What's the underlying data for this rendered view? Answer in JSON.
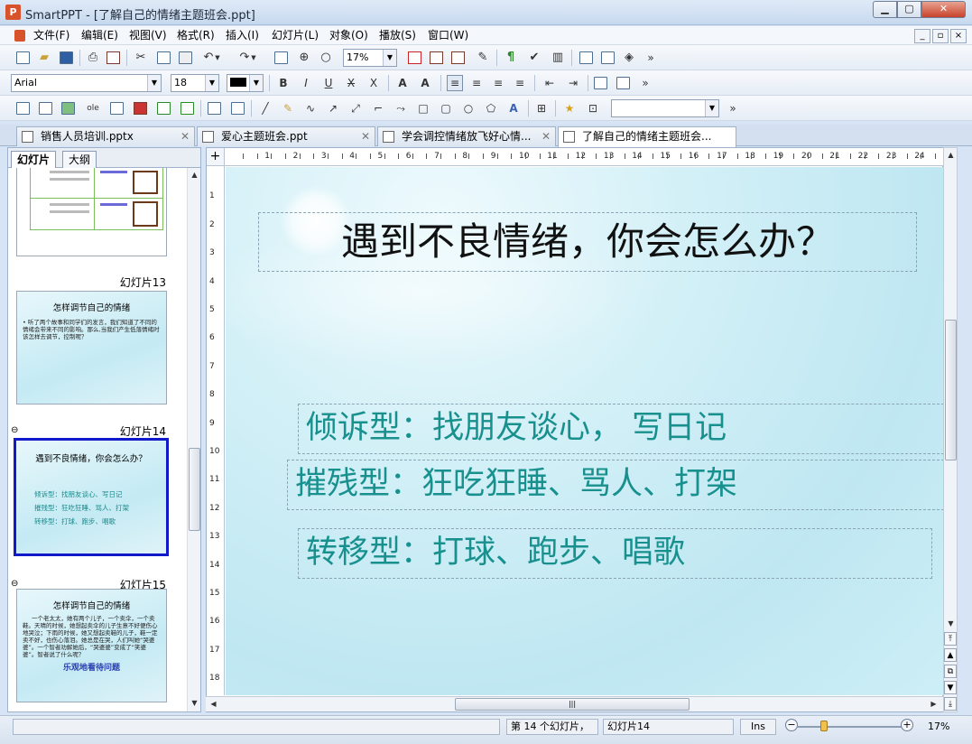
{
  "window": {
    "title": "SmartPPT - [了解自己的情绪主题班会.ppt]",
    "app_icon": "P",
    "min": "▁",
    "max": "▢",
    "close": "✕"
  },
  "menu": [
    "文件(F)",
    "编辑(E)",
    "视图(V)",
    "格式(R)",
    "插入(I)",
    "幻灯片(L)",
    "对象(O)",
    "播放(S)",
    "窗口(W)"
  ],
  "toolbar1": {
    "zoom": "17%",
    "more": "»"
  },
  "toolbar2": {
    "font": "Arial",
    "size": "18",
    "more": "»"
  },
  "toolbar3": {
    "more": "»"
  },
  "tabs": [
    "销售人员培训.pptx",
    "爱心主题班会.ppt",
    "学会调控情绪放飞好心情...",
    "了解自己的情绪主题班会..."
  ],
  "panel_tabs": [
    "幻灯片",
    "大纲"
  ],
  "thumbnails": [
    {
      "label": "幻灯片13",
      "title": "怎样调节自己的情绪",
      "body": "• 听了两个故事和同学们的发言，我们知道了不同的情绪会带来不同的影响。那么,当我们产生低落情绪时该怎样去调节，控制呢？"
    },
    {
      "label": "幻灯片14",
      "title": "遇到不良情绪，你会怎么办？",
      "lines": [
        "倾诉型：找朋友谈心、写日记",
        "摧残型：狂吃狂睡、骂人、打架",
        "转移型：打球、跑步、唱歌"
      ]
    },
    {
      "label": "幻灯片15",
      "title": "怎样调节自己的情绪",
      "body": "一个老太太，她有两个儿子，一个卖伞，一个卖鞋。天晴的时候，她想起卖伞的儿子生意不好便伤心地哭泣；下雨的时候，她又想起卖鞋的儿子，鞋一定卖不好，也伤心落泪。她总是在哭，人们叫她“哭婆婆”。一个智者劝解她后，“哭婆婆”变成了“笑婆婆”。智者说了什么呢？",
      "footer": "乐观地看待问题"
    }
  ],
  "slide": {
    "title": "遇到不良情绪，你会怎么办？",
    "bullets": [
      "倾诉型：找朋友谈心， 写日记",
      "摧残型：狂吃狂睡、骂人、打架",
      "转移型：打球、跑步、唱歌"
    ]
  },
  "status": {
    "count": "第 14 个幻灯片，",
    "name": "幻灯片14",
    "mode": "Ins",
    "zoom": "17%"
  }
}
